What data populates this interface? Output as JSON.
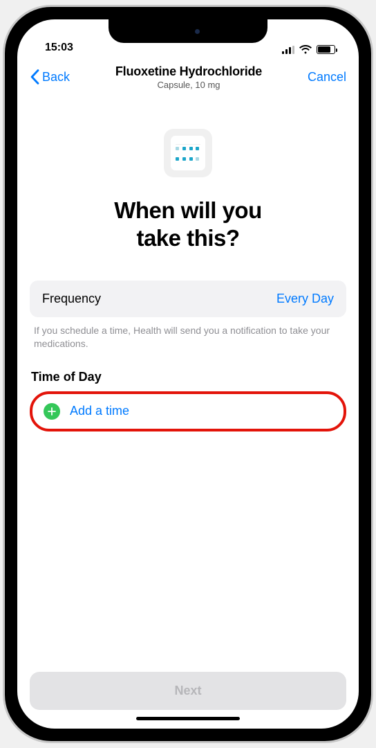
{
  "status": {
    "time": "15:03"
  },
  "nav": {
    "back_label": "Back",
    "title": "Fluoxetine Hydrochloride",
    "subtitle": "Capsule, 10 mg",
    "cancel_label": "Cancel"
  },
  "headline_line1": "When will you",
  "headline_line2": "take this?",
  "frequency": {
    "label": "Frequency",
    "value": "Every Day"
  },
  "help_text": "If you schedule a time, Health will send you a notification to take your medications.",
  "time_section": {
    "label": "Time of Day",
    "add_label": "Add a time"
  },
  "next_label": "Next"
}
